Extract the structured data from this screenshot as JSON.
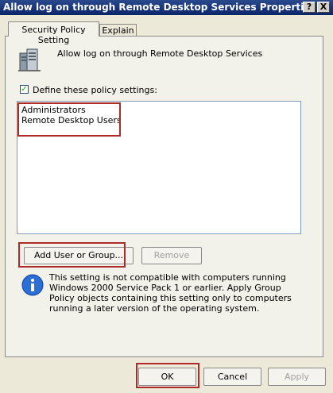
{
  "window": {
    "title": "Allow log on through Remote Desktop Services Properties",
    "help_label": "?",
    "close_label": "X"
  },
  "tabs": [
    {
      "label": "Security Policy Setting"
    },
    {
      "label": "Explain"
    }
  ],
  "policy": {
    "title": "Allow log on through Remote Desktop Services",
    "define_label": "Define these policy settings:",
    "define_checked": true,
    "checkbox_mark": "✓"
  },
  "list_items": [
    "Administrators",
    "Remote Desktop Users"
  ],
  "buttons": {
    "add": "Add User or Group...",
    "remove": "Remove",
    "ok": "OK",
    "cancel": "Cancel",
    "apply": "Apply"
  },
  "info": {
    "icon": "info-icon",
    "text": "This setting is not compatible with computers running Windows 2000 Service Pack 1 or earlier.  Apply Group Policy objects containing this setting only to computers running a later version of the operating system."
  },
  "colors": {
    "titlebar": "#0a246a",
    "highlight": "#b02a2a"
  }
}
